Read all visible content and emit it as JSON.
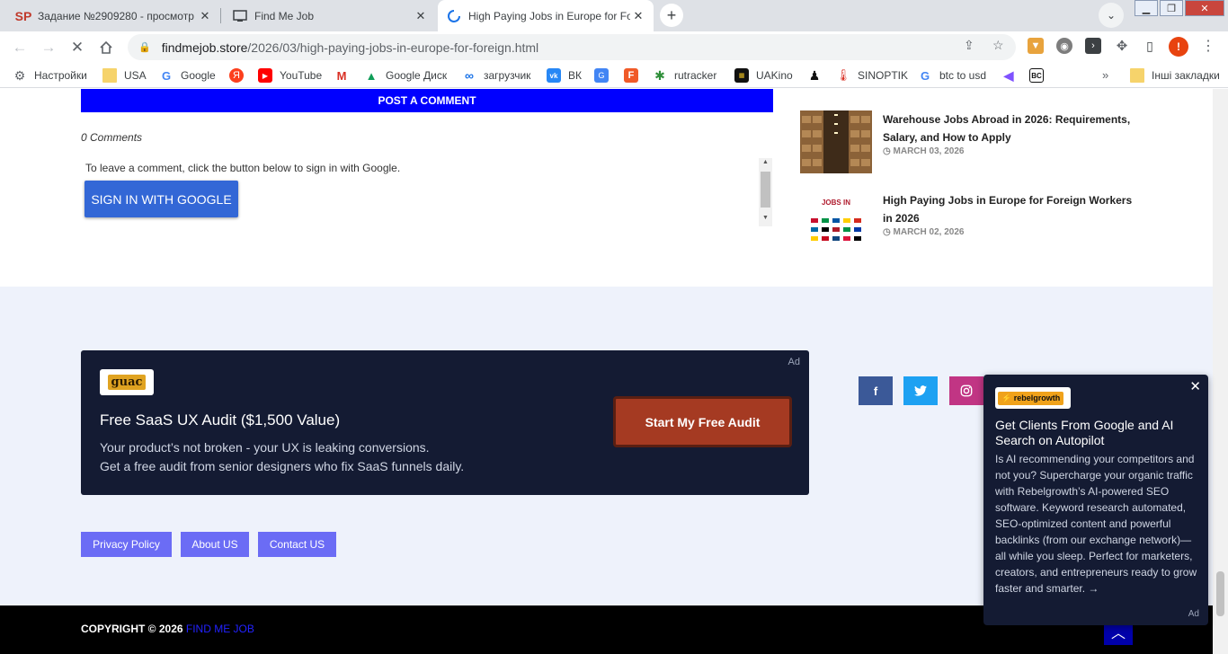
{
  "browser": {
    "tabs": [
      {
        "title": "Задание №2909280 - просмотр",
        "active": false
      },
      {
        "title": "Find Me Job",
        "active": false
      },
      {
        "title": "High Paying Jobs in Europe for Fo",
        "active": true
      }
    ],
    "new_tab_label": "+",
    "url_domain": "findmejob.store",
    "url_path": "/2026/03/high-paying-jobs-in-europe-for-foreign.html",
    "profile_initial": "!"
  },
  "bookmarks": [
    {
      "label": "Настройки",
      "icon": "gear-icon"
    },
    {
      "label": "USA",
      "icon": "folder-icon"
    },
    {
      "label": "Google",
      "icon": "google-icon"
    },
    {
      "label": "",
      "icon": "yandex-icon"
    },
    {
      "label": "YouTube",
      "icon": "youtube-icon"
    },
    {
      "label": "",
      "icon": "gmail-icon"
    },
    {
      "label": "Google Диск",
      "icon": "drive-icon"
    },
    {
      "label": "загрузчик",
      "icon": "infinity-icon"
    },
    {
      "label": "ВК",
      "icon": "vk-icon"
    },
    {
      "label": "",
      "icon": "translate-icon"
    },
    {
      "label": "",
      "icon": "f-icon"
    },
    {
      "label": "rutracker",
      "icon": "rutracker-icon"
    },
    {
      "label": "UAKino",
      "icon": "uakino-icon"
    },
    {
      "label": "",
      "icon": "figure-icon"
    },
    {
      "label": "SINOPTIK",
      "icon": "thermometer-icon"
    },
    {
      "label": "btc to usd",
      "icon": "google-icon"
    },
    {
      "label": "",
      "icon": "kotlin-icon"
    },
    {
      "label": "",
      "icon": "bc-icon"
    }
  ],
  "bookmarks_other": "Інші закладки",
  "comments": {
    "post_comment_label": "POST A COMMENT",
    "count_label": "0 Comments",
    "sign_in_prompt": "To leave a comment, click the button below to sign in with Google.",
    "google_button": "SIGN IN WITH GOOGLE"
  },
  "sidebar_posts": [
    {
      "title": "Warehouse Jobs Abroad in 2026: Requirements, Salary, and How to Apply",
      "date": "MARCH 03, 2026"
    },
    {
      "title": "High Paying Jobs in Europe for Foreign Workers in 2026",
      "date": "MARCH 02, 2026"
    }
  ],
  "thumb_text": "JOBS IN",
  "ad": {
    "tag": "Ad",
    "logo": "guac",
    "headline": "Free SaaS UX Audit ($1,500 Value)",
    "line1": "Your product’s not broken - your UX is leaking conversions.",
    "line2": "Get a free audit from senior designers who fix SaaS funnels daily.",
    "cta": "Start My Free Audit"
  },
  "social": [
    {
      "name": "facebook",
      "glyph": "f",
      "color": "#3b5998"
    },
    {
      "name": "twitter",
      "glyph": "🐦",
      "color": "#1da1f2"
    },
    {
      "name": "instagram",
      "glyph": "◎",
      "color": "#c13584"
    }
  ],
  "footer_links": [
    "Privacy Policy",
    "About US",
    "Contact US"
  ],
  "copyright": {
    "prefix": "COPYRIGHT © 2026",
    "brand": "FIND ME JOB"
  },
  "popup": {
    "logo": "rebelgrowth",
    "title": "Get Clients From Google and AI Search on Autopilot",
    "description": "Is AI recommending your competitors and not you? Supercharge your organic traffic with Rebelgrowth’s AI-powered SEO software. Keyword research automated, SEO-optimized content and powerful backlinks (from our exchange network)—all while you sleep. Perfect for marketers, creators, and entrepreneurs ready to grow faster and smarter. →",
    "tag": "Ad"
  }
}
